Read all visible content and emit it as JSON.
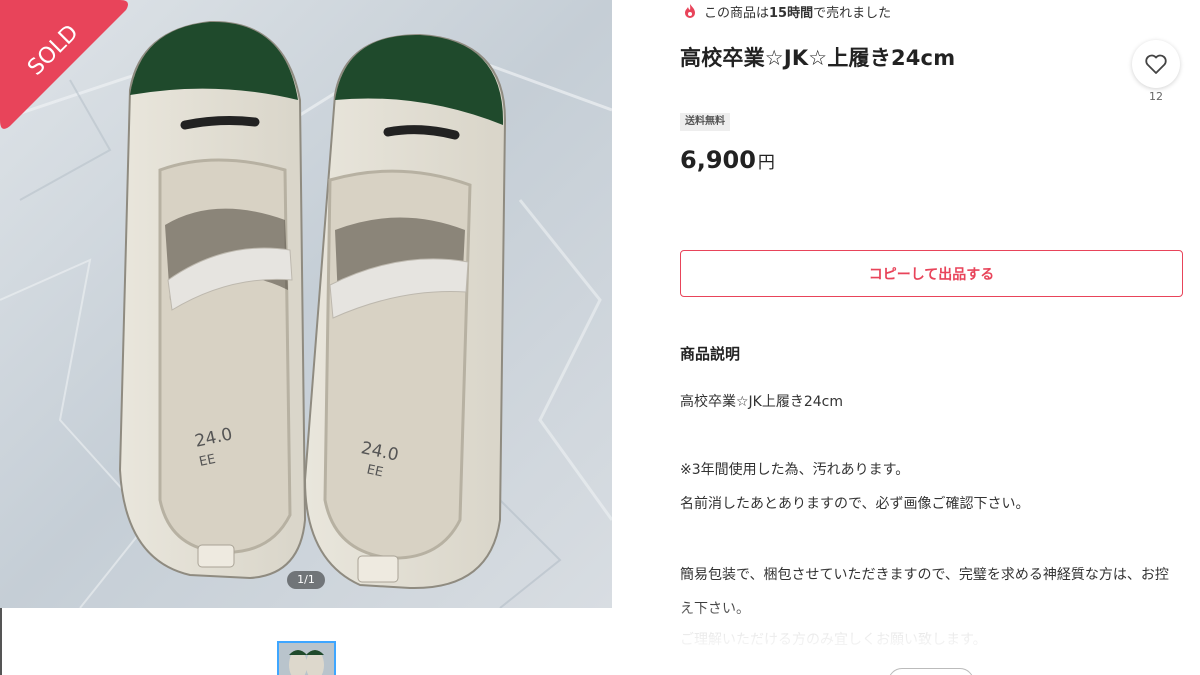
{
  "gallery": {
    "sold_label": "SOLD",
    "image_counter": "1/1",
    "main_image_icon": "photo-shoes-icon"
  },
  "item": {
    "sold_timer_prefix": "この商品は",
    "sold_timer_bold": "15時間",
    "sold_timer_suffix": "で売れました",
    "title": "高校卒業☆JK☆上履き24cm",
    "likes": "12",
    "shipping_badge": "送料無料",
    "price_amount": "6,900",
    "price_unit": "円",
    "copy_button_label": "コピーして出品する"
  },
  "description": {
    "heading": "商品説明",
    "lines": [
      "高校卒業☆JK上履き24cm",
      "",
      "※3年間使用した為、汚れあります。",
      "名前消したあとありますので、必ず画像ご確認下さい。",
      "",
      "簡易包装で、梱包させていただきますので、完璧を求める神経質な方は、お控え下さい。",
      "ご理解いただける方のみ宜しくお願い致します。"
    ]
  },
  "colors": {
    "accent": "#e8445a",
    "sold_ribbon": "#e8445a",
    "thumbnail_border": "#3ea6ff"
  }
}
